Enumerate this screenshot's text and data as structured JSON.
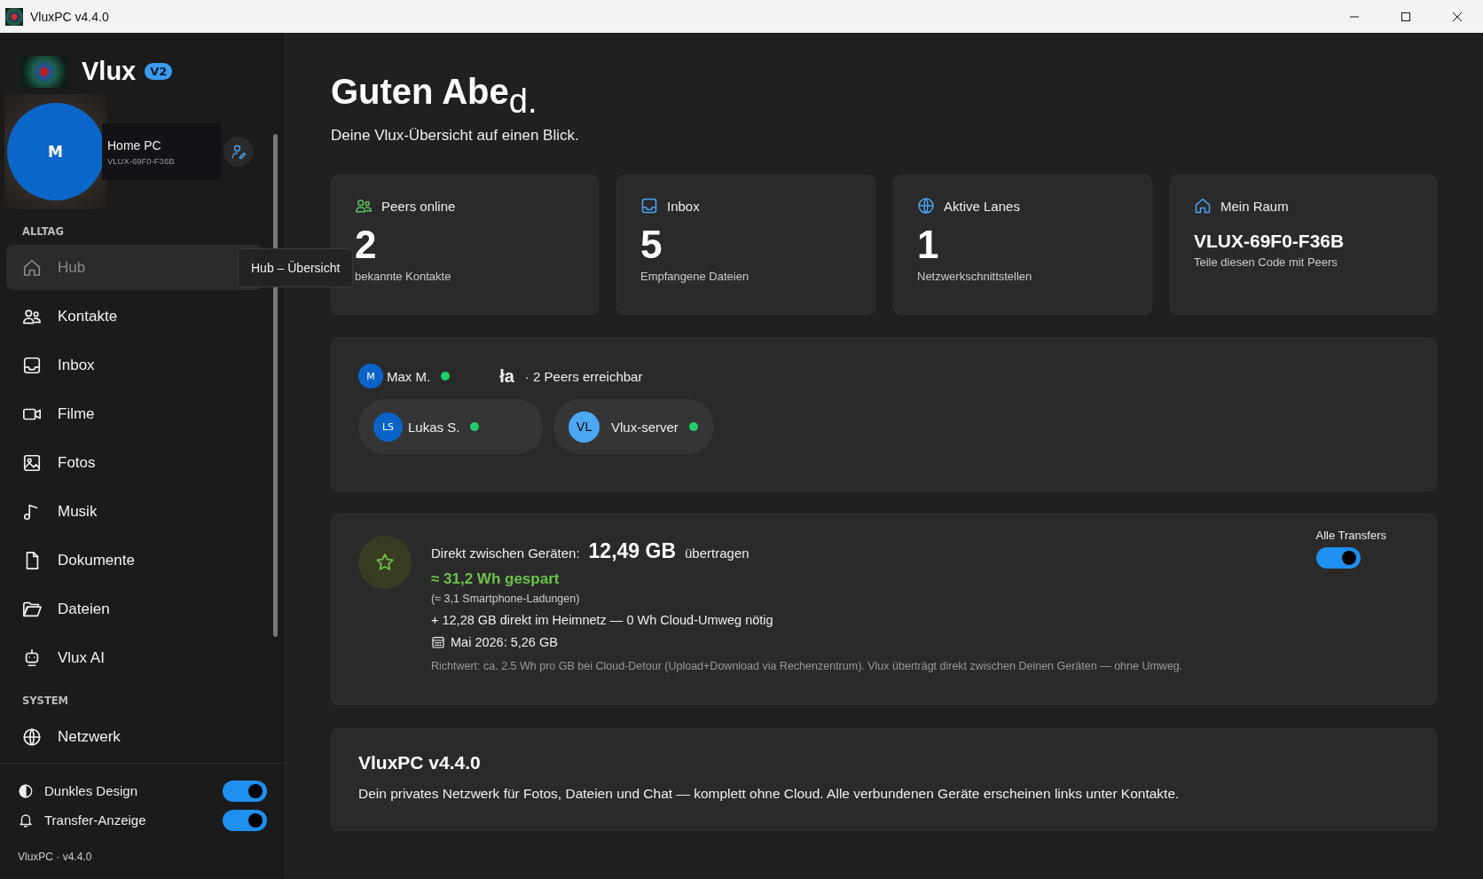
{
  "window": {
    "title": "VluxPC v4.4.0"
  },
  "sidebar": {
    "brand": "Vlux",
    "badge": "V2",
    "profile": {
      "initial": "M",
      "name": "Home PC",
      "code": "VLUX-69F0-F36B"
    },
    "sections": [
      {
        "label": "ALLTAG",
        "items": [
          {
            "label": "Hub",
            "selected": true
          },
          {
            "label": "Kontakte",
            "selected": false
          },
          {
            "label": "Inbox",
            "selected": false
          },
          {
            "label": "Filme",
            "selected": false
          },
          {
            "label": "Fotos",
            "selected": false
          },
          {
            "label": "Musik",
            "selected": false
          },
          {
            "label": "Dokumente",
            "selected": false
          },
          {
            "label": "Dateien",
            "selected": false
          },
          {
            "label": "Vlux AI",
            "selected": false
          }
        ]
      },
      {
        "label": "SYSTEM",
        "items": [
          {
            "label": "Netzwerk",
            "selected": false
          }
        ]
      }
    ],
    "tooltip": "Hub – Übersicht",
    "toggles": [
      {
        "label": "Dunkles Design",
        "on": true
      },
      {
        "label": "Transfer-Anzeige",
        "on": true
      }
    ],
    "footer": "VluxPC · v4.4.0"
  },
  "header": {
    "title": "Guten Abe",
    "title_tail": "d.",
    "subtitle": "Deine Vlux-Übersicht auf einen Blick."
  },
  "stats": [
    {
      "label": "Peers online",
      "value": "2",
      "caption": "bekannte Kontakte",
      "kind": "number"
    },
    {
      "label": "Inbox",
      "value": "5",
      "caption": "Empfangene Dateien",
      "kind": "number"
    },
    {
      "label": "Aktive Lanes",
      "value": "1",
      "caption": "Netzwerkschnittstellen",
      "kind": "number"
    },
    {
      "label": "Mein Raum",
      "value": "VLUX-69F0-F36B",
      "caption": "Teile diesen Code mit Peers",
      "kind": "code"
    }
  ],
  "peers": {
    "me": {
      "initials": "M",
      "name": "Max M.",
      "online": true
    },
    "glitch": "ła",
    "summary": "· 2 Peers erreichbar",
    "list": [
      {
        "initials": "LS",
        "name": "Lukas S.",
        "online": true,
        "color": "#0b63c9"
      },
      {
        "initials": "VL",
        "name": "Vlux-server",
        "online": true,
        "color": "#4aa8f5"
      }
    ]
  },
  "transfer": {
    "lead": "Direkt zwischen Geräten:",
    "amount": "12,49 GB",
    "suffix": "übertragen",
    "saved": "≈ 31,2 Wh gespart",
    "equivalent": "(≈ 3,1 Smartphone-Ladungen)",
    "home": "+ 12,28 GB direkt im Heimnetz — 0 Wh Cloud-Umweg nötig",
    "month": "Mai 2026: 5,26 GB",
    "note": "Richtwert: ca. 2.5 Wh pro GB bei Cloud-Detour (Upload+Download via Rechenzentrum). Vlux überträgt direkt zwischen Deinen Geräten — ohne Umweg.",
    "toggle_label": "Alle Transfers",
    "toggle_on": true
  },
  "about": {
    "title": "VluxPC v4.4.0",
    "text": "Dein privates Netzwerk für Fotos, Dateien und Chat — komplett ohne Cloud. Alle verbundenen Geräte erscheinen links unter Kontakte."
  }
}
